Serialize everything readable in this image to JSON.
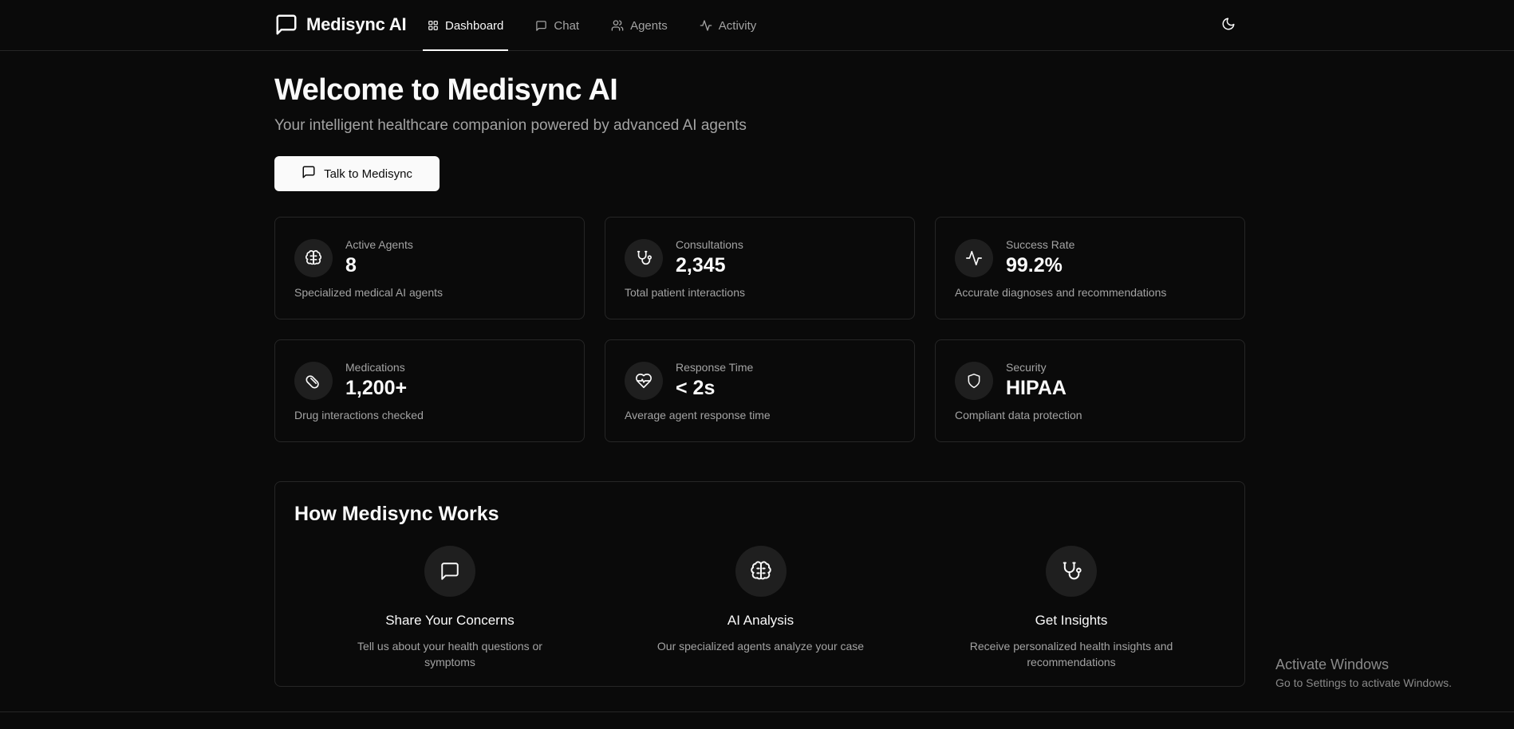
{
  "app": {
    "name": "Medisync AI"
  },
  "nav": {
    "items": [
      {
        "label": "Dashboard",
        "icon": "grid-icon",
        "active": true
      },
      {
        "label": "Chat",
        "icon": "chat-icon",
        "active": false
      },
      {
        "label": "Agents",
        "icon": "users-icon",
        "active": false
      },
      {
        "label": "Activity",
        "icon": "activity-icon",
        "active": false
      }
    ],
    "theme_toggle_icon": "moon-icon"
  },
  "hero": {
    "title": "Welcome to Medisync AI",
    "subtitle": "Your intelligent healthcare companion powered by advanced AI agents",
    "cta_label": "Talk to Medisync"
  },
  "stats": [
    {
      "label": "Active Agents",
      "value": "8",
      "desc": "Specialized medical AI agents",
      "icon": "brain-icon"
    },
    {
      "label": "Consultations",
      "value": "2,345",
      "desc": "Total patient interactions",
      "icon": "stethoscope-icon"
    },
    {
      "label": "Success Rate",
      "value": "99.2%",
      "desc": "Accurate diagnoses and recommendations",
      "icon": "activity-icon"
    },
    {
      "label": "Medications",
      "value": "1,200+",
      "desc": "Drug interactions checked",
      "icon": "pill-icon"
    },
    {
      "label": "Response Time",
      "value": "< 2s",
      "desc": "Average agent response time",
      "icon": "heart-pulse-icon"
    },
    {
      "label": "Security",
      "value": "HIPAA",
      "desc": "Compliant data protection",
      "icon": "shield-icon"
    }
  ],
  "how": {
    "title": "How Medisync Works",
    "steps": [
      {
        "title": "Share Your Concerns",
        "desc": "Tell us about your health questions or symptoms",
        "icon": "chat-icon"
      },
      {
        "title": "AI Analysis",
        "desc": "Our specialized agents analyze your case",
        "icon": "brain-icon"
      },
      {
        "title": "Get Insights",
        "desc": "Receive personalized health insights and recommendations",
        "icon": "stethoscope-icon"
      }
    ]
  },
  "watermark": {
    "line1": "Activate Windows",
    "line2": "Go to Settings to activate Windows."
  },
  "colors": {
    "background": "#0a0a0a",
    "foreground": "#fafafa",
    "muted": "#a3a3a3",
    "border": "#262626",
    "icon_bg": "#1f1f1f"
  }
}
